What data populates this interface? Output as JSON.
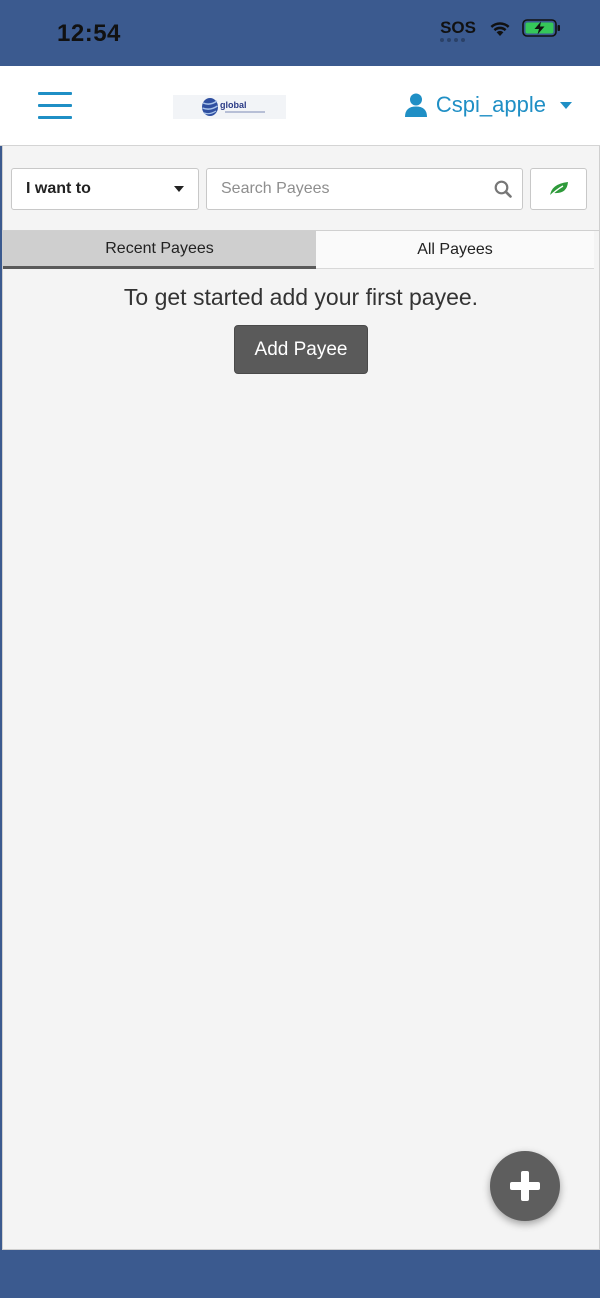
{
  "status_bar": {
    "time": "12:54",
    "sos": "SOS"
  },
  "header": {
    "logo_text": "global",
    "user_name": "Cspi_apple"
  },
  "toolbar": {
    "i_want_label": "I want to",
    "search_placeholder": "Search Payees"
  },
  "tabs": [
    {
      "label": "Recent Payees",
      "active": true
    },
    {
      "label": "All Payees",
      "active": false
    }
  ],
  "main": {
    "empty_message": "To get started add your first payee.",
    "add_payee_label": "Add Payee"
  },
  "colors": {
    "brand_bar": "#3b5a8f",
    "accent": "#1f8fc5",
    "button_dark": "#5a5a5a",
    "leaf_green": "#2e9a3a",
    "battery_green": "#35c759"
  },
  "icons": [
    "wifi-icon",
    "battery-charging-icon",
    "hamburger-menu-icon",
    "user-icon",
    "chevron-down-icon",
    "search-icon",
    "leaf-icon",
    "plus-icon"
  ]
}
